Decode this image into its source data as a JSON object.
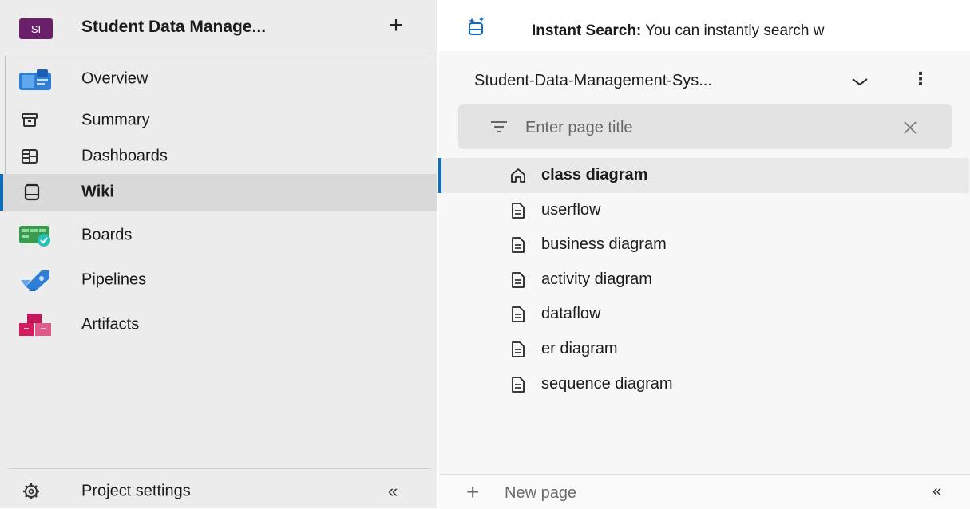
{
  "project": {
    "avatar": "SI",
    "name": "Student Data Manage...",
    "add_icon": "plus-icon"
  },
  "nav": {
    "items": [
      {
        "label": "Overview",
        "icon": "overview-icon"
      },
      {
        "label": "Summary",
        "icon": "summary-icon"
      },
      {
        "label": "Dashboards",
        "icon": "dashboards-icon"
      },
      {
        "label": "Wiki",
        "icon": "wiki-icon"
      },
      {
        "label": "Boards",
        "icon": "boards-icon"
      },
      {
        "label": "Pipelines",
        "icon": "pipelines-icon"
      },
      {
        "label": "Artifacts",
        "icon": "artifacts-icon"
      }
    ],
    "selected": "Wiki",
    "settings_label": "Project settings",
    "collapse_glyph": "«"
  },
  "banner": {
    "bold": "Instant Search:",
    "text": " You can instantly search w"
  },
  "wiki": {
    "name": "Student-Data-Management-Sys...",
    "filter_placeholder": "Enter page title",
    "pages": [
      {
        "label": "class diagram",
        "icon": "home-icon"
      },
      {
        "label": "userflow",
        "icon": "page-icon"
      },
      {
        "label": "business diagram",
        "icon": "page-icon"
      },
      {
        "label": "activity diagram",
        "icon": "page-icon"
      },
      {
        "label": "dataflow",
        "icon": "page-icon"
      },
      {
        "label": "er diagram",
        "icon": "page-icon"
      },
      {
        "label": "sequence diagram",
        "icon": "page-icon"
      }
    ],
    "selected_page": "class diagram",
    "new_page_label": "New page",
    "collapse_glyph": "«"
  },
  "colors": {
    "accent": "#0f6cbd",
    "project_avatar": "#6b1f6b",
    "nav_bg": "#ececec",
    "nav_selected": "#d9d9d9"
  }
}
